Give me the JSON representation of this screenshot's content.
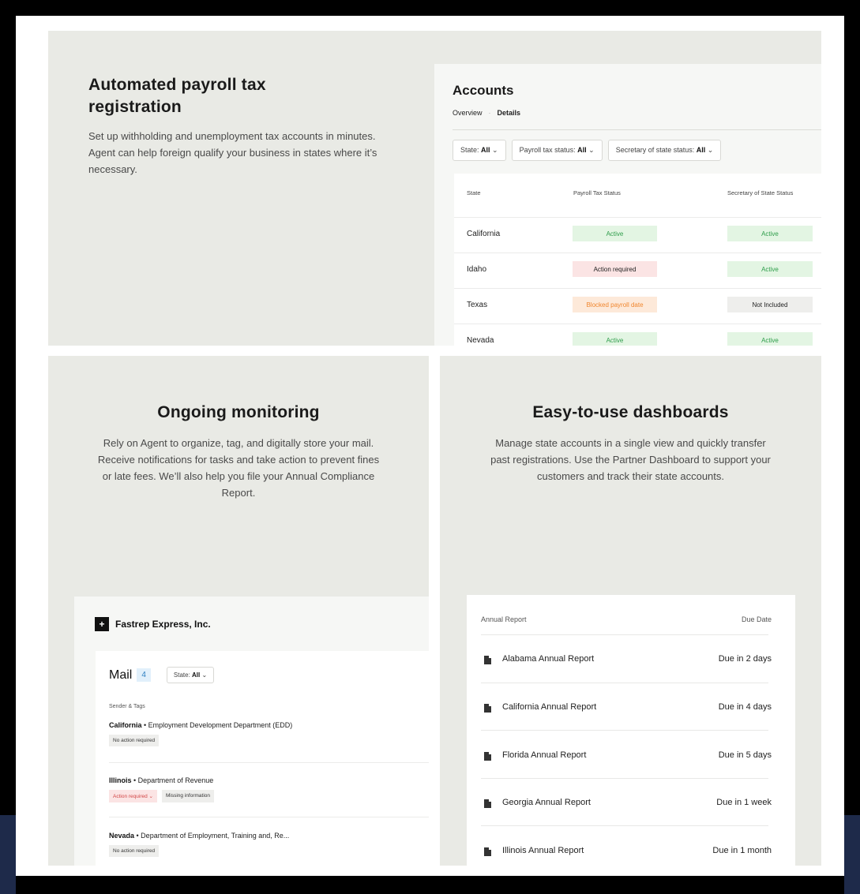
{
  "top": {
    "title": "Automated payroll tax registration",
    "description": "Set up withholding and unemployment tax accounts in minutes. Agent can help foreign qualify your business in states where it’s necessary."
  },
  "accounts": {
    "title": "Accounts",
    "tabs": [
      "Overview",
      "Details"
    ],
    "filters": [
      {
        "label": "State: ",
        "value": "All"
      },
      {
        "label": "Payroll tax status: ",
        "value": "All"
      },
      {
        "label": "Secretary of state status: ",
        "value": "All"
      }
    ],
    "columns": [
      "State",
      "Payroll Tax Status",
      "Secretary of State Status"
    ],
    "rows": [
      {
        "state": "California",
        "payroll": "Active",
        "sos": "Active"
      },
      {
        "state": "Idaho",
        "payroll": "Action required",
        "sos": "Active"
      },
      {
        "state": "Texas",
        "payroll": "Blocked payroll date",
        "sos": "Not Included"
      },
      {
        "state": "Nevada",
        "payroll": "Active",
        "sos": "Active"
      }
    ]
  },
  "monitoring": {
    "title": "Ongoing monitoring",
    "description": "Rely on Agent to organize, tag, and digitally store your mail. Receive notifications for tasks and take action to prevent fines or late fees. We’ll also help you file your Annual Compliance Report."
  },
  "mail": {
    "company": "Fastrep Express, Inc.",
    "title": "Mail",
    "count": "4",
    "filter_label": "State: ",
    "filter_value": "All",
    "sender_label": "Sender & Tags",
    "items": [
      {
        "state": "California",
        "dept": " • Employment Development Department (EDD)",
        "tags": [
          "No action required"
        ]
      },
      {
        "state": "Illinois",
        "dept": " • Department of Revenue",
        "tags": [
          "Action required",
          "Missing information"
        ]
      },
      {
        "state": "Nevada",
        "dept": " • Department of Employment, Training and, Re...",
        "tags": [
          "No action required"
        ]
      }
    ]
  },
  "dashboards": {
    "title": "Easy-to-use dashboards",
    "description": "Manage state accounts in a single view and quickly transfer past registrations. Use the Partner Dashboard to support your customers and track their state accounts."
  },
  "reports": {
    "col_name": "Annual Report",
    "col_due": "Due Date",
    "rows": [
      {
        "name": "Alabama Annual Report",
        "due": "Due in 2 days"
      },
      {
        "name": "California Annual Report",
        "due": "Due in 4 days"
      },
      {
        "name": "Florida Annual Report",
        "due": "Due in 5 days"
      },
      {
        "name": "Georgia Annual Report",
        "due": "Due in 1 week"
      },
      {
        "name": "Illinois Annual Report",
        "due": "Due in 1 month"
      }
    ]
  },
  "colors": {
    "panel": "#e9eae5",
    "active_bg": "#e3f5e3",
    "active_text": "#2e9d4a",
    "action_bg": "#fbe4e4",
    "blocked_bg": "#fde9d9",
    "blocked_text": "#f0862e",
    "neutral_bg": "#eeeeec"
  }
}
